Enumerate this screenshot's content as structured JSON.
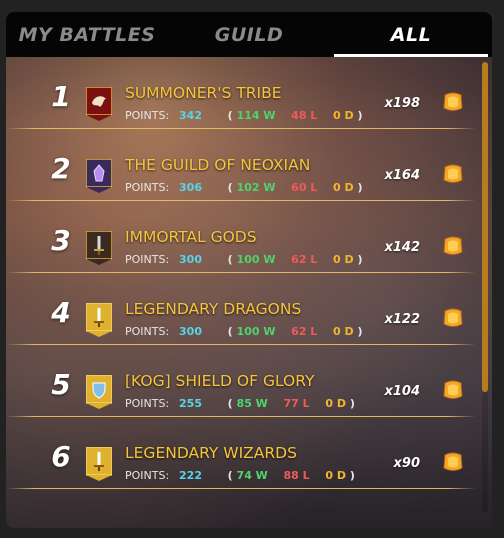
{
  "tabs": [
    {
      "label": "MY BATTLES",
      "active": false
    },
    {
      "label": "GUILD",
      "active": false
    },
    {
      "label": "ALL",
      "active": true
    }
  ],
  "points_label": "POINTS:",
  "rows": [
    {
      "rank": "1",
      "name": "SUMMONER'S TRIBE",
      "points": "342",
      "wins": "114 W",
      "losses": "48 L",
      "draws": "0 D",
      "reward": "x198",
      "banner": "red-tribal-banner"
    },
    {
      "rank": "2",
      "name": "THE GUILD OF NEOXIAN",
      "points": "306",
      "wins": "102 W",
      "losses": "60 L",
      "draws": "0 D",
      "reward": "x164",
      "banner": "purple-crystal-banner"
    },
    {
      "rank": "3",
      "name": "IMMORTAL GODS",
      "points": "300",
      "wins": "100 W",
      "losses": "62 L",
      "draws": "0 D",
      "reward": "x142",
      "banner": "dark-sword-banner"
    },
    {
      "rank": "4",
      "name": "LEGENDARY DRAGONS",
      "points": "300",
      "wins": "100 W",
      "losses": "62 L",
      "draws": "0 D",
      "reward": "x122",
      "banner": "gold-sword-banner"
    },
    {
      "rank": "5",
      "name": "[KOG] SHIELD OF GLORY",
      "points": "255",
      "wins": "85 W",
      "losses": "77 L",
      "draws": "0 D",
      "reward": "x104",
      "banner": "gold-shield-banner"
    },
    {
      "rank": "6",
      "name": "LEGENDARY WIZARDS",
      "points": "222",
      "wins": "74 W",
      "losses": "88 L",
      "draws": "0 D",
      "reward": "x90",
      "banner": "gold-sword-banner"
    }
  ],
  "colors": {
    "name": "#f5c63b",
    "points": "#58d4e6",
    "wins": "#4fd46b",
    "losses": "#ef5a5a",
    "draws": "#f1b630",
    "accent": "#b77c1b"
  },
  "icons": {
    "reward": "merit-coin-icon"
  }
}
